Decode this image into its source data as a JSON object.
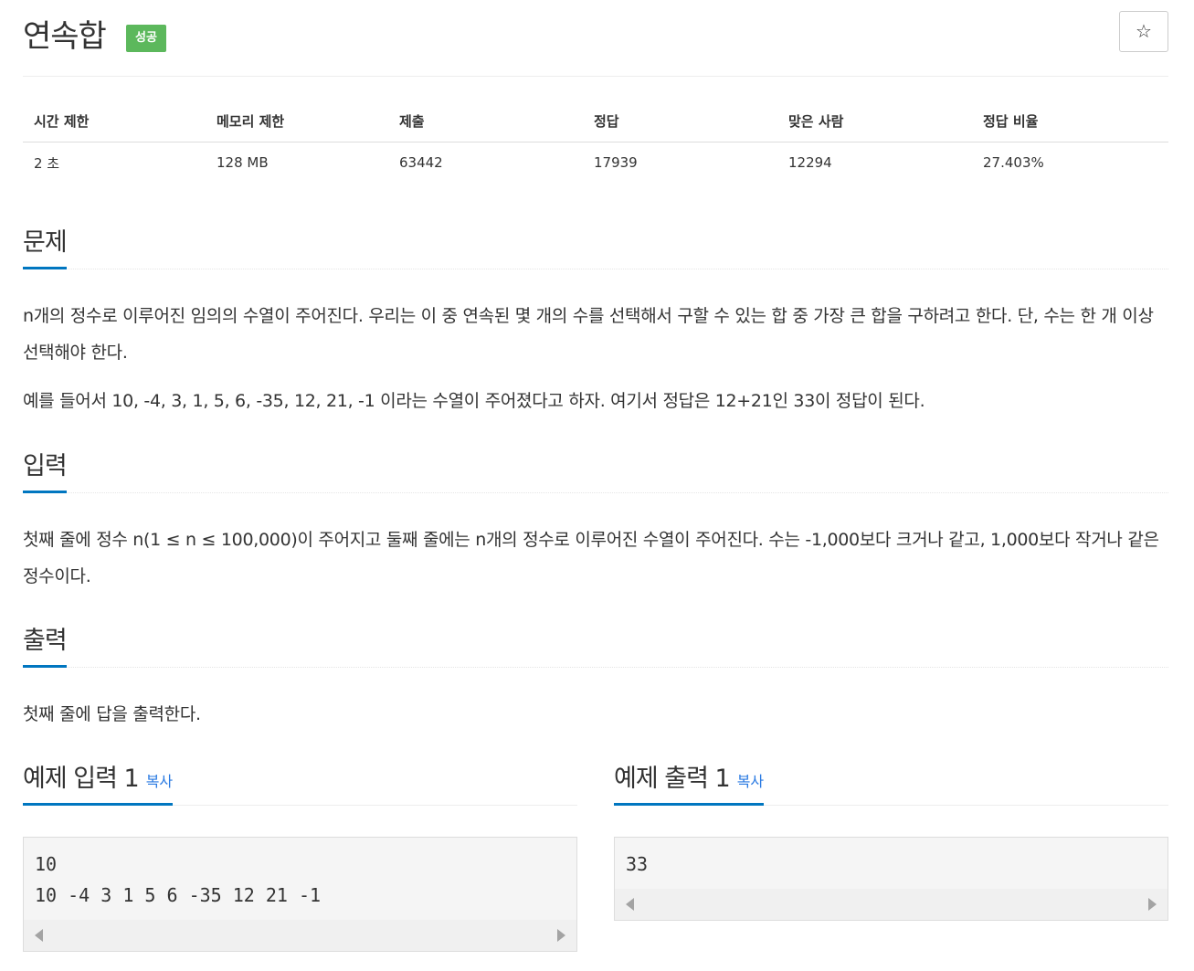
{
  "problem": {
    "title": "연속합",
    "badge": "성공",
    "star_label": "☆"
  },
  "info_table": {
    "headers": [
      "시간 제한",
      "메모리 제한",
      "제출",
      "정답",
      "맞은 사람",
      "정답 비율"
    ],
    "values": [
      "2 초",
      "128 MB",
      "63442",
      "17939",
      "12294",
      "27.403%"
    ]
  },
  "sections": {
    "problem": {
      "heading": "문제",
      "paragraphs": [
        "n개의 정수로 이루어진 임의의 수열이 주어진다. 우리는 이 중 연속된 몇 개의 수를 선택해서 구할 수 있는 합 중 가장 큰 합을 구하려고 한다. 단, 수는 한 개 이상 선택해야 한다.",
        "예를 들어서 10, -4, 3, 1, 5, 6, -35, 12, 21, -1 이라는 수열이 주어졌다고 하자. 여기서 정답은 12+21인 33이 정답이 된다."
      ]
    },
    "input": {
      "heading": "입력",
      "text": "첫째 줄에 정수 n(1 ≤ n ≤ 100,000)이 주어지고 둘째 줄에는 n개의 정수로 이루어진 수열이 주어진다. 수는 -1,000보다 크거나 같고, 1,000보다 작거나 같은 정수이다."
    },
    "output": {
      "heading": "출력",
      "text": "첫째 줄에 답을 출력한다."
    }
  },
  "samples": {
    "input": {
      "heading": "예제 입력 1",
      "copy_label": "복사",
      "lines": [
        "10",
        "10 -4 3 1 5 6 -35 12 21 -1"
      ]
    },
    "output": {
      "heading": "예제 출력 1",
      "copy_label": "복사",
      "lines": [
        "33"
      ]
    }
  },
  "colors": {
    "badge_success": "#5cb85c",
    "heading_underline": "#0076c0",
    "link": "#2a7ae2"
  }
}
